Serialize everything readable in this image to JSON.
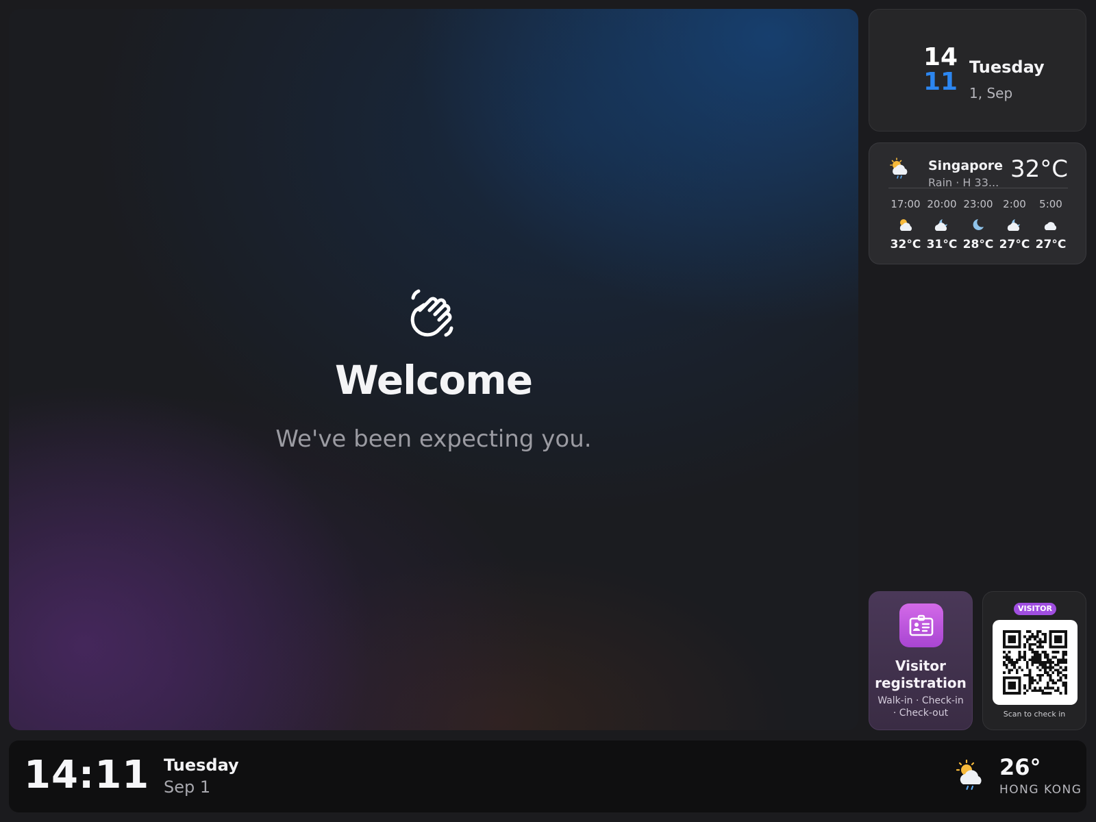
{
  "hero": {
    "icon": "waving-hand-icon",
    "title": "Welcome",
    "subtitle": "We've been expecting you."
  },
  "date_card": {
    "hour": "14",
    "minute": "11",
    "day": "Tuesday",
    "date": "1, Sep",
    "accent_color": "#2c86f0"
  },
  "weather_card": {
    "icon": "sun-cloud-rain-icon",
    "city": "Singapore",
    "condition": "Rain · H 33...",
    "temperature": "32°C",
    "hourly": [
      {
        "time": "17:00",
        "icon": "sun-cloud-icon",
        "temp": "32°C"
      },
      {
        "time": "20:00",
        "icon": "moon-cloud-icon",
        "temp": "31°C"
      },
      {
        "time": "23:00",
        "icon": "moon-icon",
        "temp": "28°C"
      },
      {
        "time": "2:00",
        "icon": "moon-cloud-icon",
        "temp": "27°C"
      },
      {
        "time": "5:00",
        "icon": "cloud-icon",
        "temp": "27°C"
      }
    ]
  },
  "registration": {
    "icon": "id-card-icon",
    "title": "Visitor registration",
    "subtitle": "Walk-in · Check-in · Check-out",
    "accent_color": "#c05ee4"
  },
  "qr": {
    "badge": "VISITOR",
    "caption": "Scan to check in",
    "badge_color": "#a04ee0"
  },
  "bottom_bar": {
    "time": "14:11",
    "day": "Tuesday",
    "date": "Sep 1",
    "weather_icon": "sun-cloud-rain-icon",
    "temperature": "26°",
    "city": "HONG KONG"
  }
}
